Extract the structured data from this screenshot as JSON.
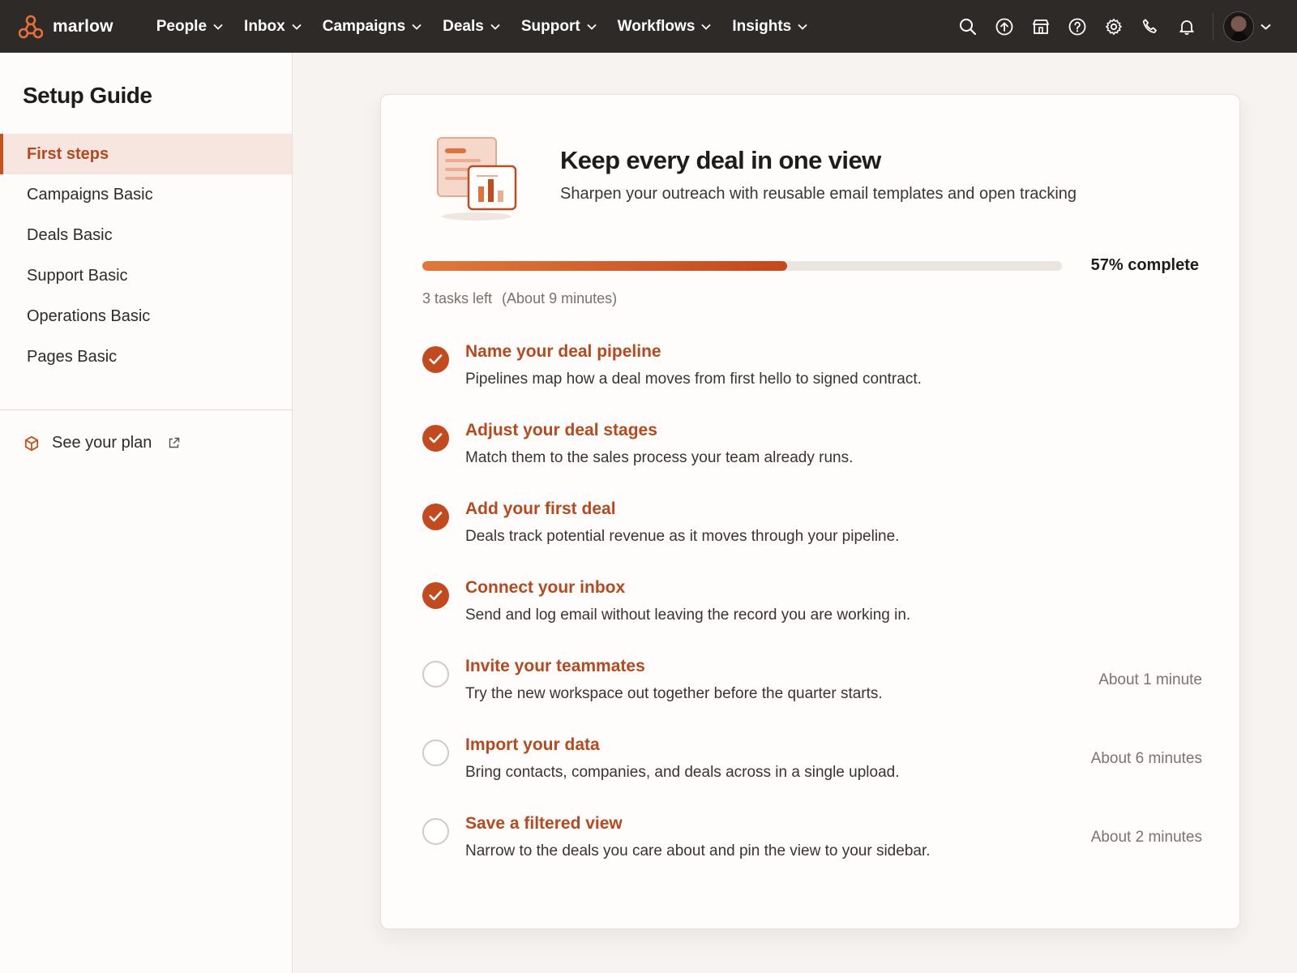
{
  "app": {
    "brand": "marlow",
    "accent_color": "#c5521f"
  },
  "topnav": {
    "menu": [
      {
        "label": "People"
      },
      {
        "label": "Inbox"
      },
      {
        "label": "Campaigns"
      },
      {
        "label": "Deals"
      },
      {
        "label": "Support"
      },
      {
        "label": "Workflows"
      },
      {
        "label": "Insights"
      }
    ],
    "icons": [
      "search-icon",
      "upgrade-icon",
      "marketplace-icon",
      "help-icon",
      "settings-icon",
      "calling-icon",
      "notifications-icon"
    ]
  },
  "sidebar": {
    "title": "Setup Guide",
    "items": [
      {
        "label": "First steps",
        "active": true
      },
      {
        "label": "Campaigns Basic"
      },
      {
        "label": "Deals Basic"
      },
      {
        "label": "Support Basic"
      },
      {
        "label": "Operations Basic"
      },
      {
        "label": "Pages Basic"
      }
    ],
    "plan_link": "See your plan"
  },
  "card": {
    "title": "Keep every deal in one view",
    "subtitle": "Sharpen your outreach with reusable email templates and open tracking",
    "progress": {
      "percent": 57,
      "label": "57% complete",
      "tasks_left": "3 tasks left",
      "estimate": "(About 9 minutes)"
    },
    "tasks": [
      {
        "title": "Name your deal pipeline",
        "description": "Pipelines map how a deal moves from first hello to signed contract.",
        "done": true,
        "time": ""
      },
      {
        "title": "Adjust your deal stages",
        "description": "Match them to the sales process your team already runs.",
        "done": true,
        "time": ""
      },
      {
        "title": "Add your first deal",
        "description": "Deals track potential revenue as it moves through your pipeline.",
        "done": true,
        "time": ""
      },
      {
        "title": "Connect your inbox",
        "description": "Send and log email without leaving the record you are working in.",
        "done": true,
        "time": ""
      },
      {
        "title": "Invite your teammates",
        "description": "Try the new workspace out together before the quarter starts.",
        "done": false,
        "time": "About 1 minute"
      },
      {
        "title": "Import your data",
        "description": "Bring contacts, companies, and deals across in a single upload.",
        "done": false,
        "time": "About 6 minutes"
      },
      {
        "title": "Save a filtered view",
        "description": "Narrow to the deals you care about and pin the view to your sidebar.",
        "done": false,
        "time": "About 2 minutes"
      }
    ]
  }
}
